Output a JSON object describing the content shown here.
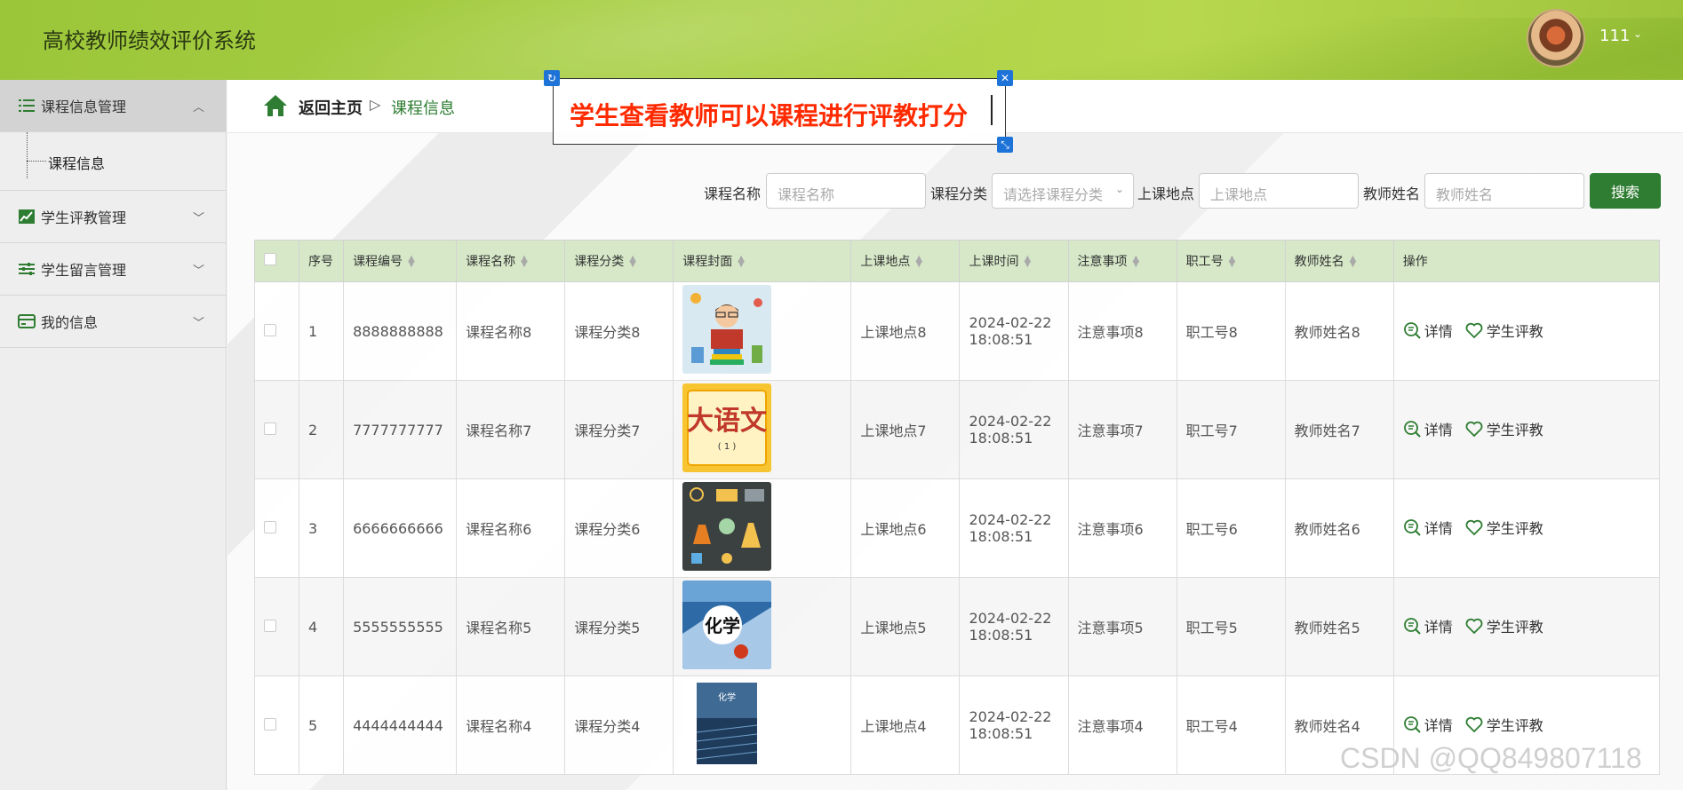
{
  "header": {
    "title": "高校教师绩效评价系统",
    "user_name": "111"
  },
  "sidebar": {
    "groups": [
      {
        "label": "课程信息管理",
        "icon": "list-icon",
        "expanded": true,
        "children": [
          "课程信息"
        ]
      },
      {
        "label": "学生评教管理",
        "icon": "chart-icon",
        "expanded": false
      },
      {
        "label": "学生留言管理",
        "icon": "sliders-icon",
        "expanded": false
      },
      {
        "label": "我的信息",
        "icon": "card-icon",
        "expanded": false
      }
    ]
  },
  "breadcrumb": {
    "home": "返回主页",
    "separator": "▷",
    "current": "课程信息"
  },
  "annotation": {
    "text": "学生查看教师可以课程进行评教打分"
  },
  "search": {
    "course_name_label": "课程名称",
    "course_name_placeholder": "课程名称",
    "category_label": "课程分类",
    "category_placeholder": "请选择课程分类",
    "location_label": "上课地点",
    "location_placeholder": "上课地点",
    "teacher_label": "教师姓名",
    "teacher_placeholder": "教师姓名",
    "button": "搜索"
  },
  "table": {
    "headers": [
      "序号",
      "课程编号",
      "课程名称",
      "课程分类",
      "课程封面",
      "上课地点",
      "上课时间",
      "注意事项",
      "职工号",
      "教师姓名",
      "操作"
    ],
    "detail_label": "详情",
    "review_label": "学生评教",
    "rows": [
      {
        "no": "1",
        "code": "8888888888",
        "name": "课程名称8",
        "category": "课程分类8",
        "cover": "reading-student-cover",
        "location": "上课地点8",
        "date": "2024-02-22",
        "time": "18:08:51",
        "notes": "注意事项8",
        "staff_no": "职工号8",
        "teacher": "教师姓名8"
      },
      {
        "no": "2",
        "code": "7777777777",
        "name": "课程名称7",
        "category": "课程分类7",
        "cover": "chinese-textbook-cover",
        "location": "上课地点7",
        "date": "2024-02-22",
        "time": "18:08:51",
        "notes": "注意事项7",
        "staff_no": "职工号7",
        "teacher": "教师姓名7"
      },
      {
        "no": "3",
        "code": "6666666666",
        "name": "课程名称6",
        "category": "课程分类6",
        "cover": "science-lab-cover",
        "location": "上课地点6",
        "date": "2024-02-22",
        "time": "18:08:51",
        "notes": "注意事项6",
        "staff_no": "职工号6",
        "teacher": "教师姓名6"
      },
      {
        "no": "4",
        "code": "5555555555",
        "name": "课程名称5",
        "category": "课程分类5",
        "cover": "chemistry-book-cover",
        "location": "上课地点5",
        "date": "2024-02-22",
        "time": "18:08:51",
        "notes": "注意事项5",
        "staff_no": "职工号5",
        "teacher": "教师姓名5"
      },
      {
        "no": "5",
        "code": "4444444444",
        "name": "课程名称4",
        "category": "课程分类4",
        "cover": "chemistry-textbook-cover",
        "location": "上课地点4",
        "date": "2024-02-22",
        "time": "18:08:51",
        "notes": "注意事项4",
        "staff_no": "职工号4",
        "teacher": "教师姓名4"
      }
    ]
  },
  "watermark": "CSDN @QQ849807118",
  "colors": {
    "primary": "#2e7d32",
    "header_green": "#a8cf44",
    "table_header": "#d6e8c8",
    "annotation_red": "#ff2a00",
    "handle_blue": "#1e73d8"
  }
}
